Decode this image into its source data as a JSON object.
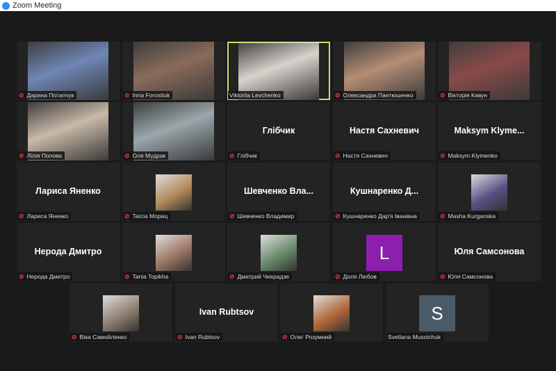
{
  "window": {
    "title": "Zoom Meeting"
  },
  "colors": {
    "active_speaker_border": "#c9e265",
    "muted_icon": "#e0393e"
  },
  "participants": [
    {
      "name": "Дарина Потапчук",
      "type": "video",
      "muted": true,
      "color": "#6f86b6"
    },
    {
      "name": "Inna Forostiuk",
      "type": "video",
      "muted": true,
      "color": "#8a6b5a"
    },
    {
      "name": "Viktoriia Levchenko",
      "type": "video",
      "muted": false,
      "active": true,
      "color": "#d9d2cc"
    },
    {
      "name": "Олександра Пантюшенко",
      "type": "video",
      "muted": true,
      "color": "#b58d75"
    },
    {
      "name": "Вікторія Кавун",
      "type": "video",
      "muted": true,
      "color": "#8a4a48"
    },
    {
      "name": "Лілія Попова",
      "type": "video",
      "muted": true,
      "color": "#c9b9a8"
    },
    {
      "name": "Оля Мудрак",
      "type": "video",
      "muted": true,
      "color": "#9aa7ab"
    },
    {
      "name": "Глібчик",
      "display": "Глібчик",
      "type": "name",
      "muted": true
    },
    {
      "name": "Настя Сахневич",
      "display": "Настя Сахневич",
      "type": "name",
      "muted": true
    },
    {
      "name": "Maksym Klymenko",
      "display": "Maksym  Klyme...",
      "type": "name",
      "muted": true
    },
    {
      "name": "Лариса Яненко",
      "display": "Лариса Яненко",
      "type": "name",
      "muted": true
    },
    {
      "name": "Taïcia Мориц",
      "type": "picture",
      "muted": true,
      "color": "#b38a5a"
    },
    {
      "name": "Шевченко Владимир",
      "display": "Шевченко  Вла...",
      "type": "name",
      "muted": true
    },
    {
      "name": "Кушнаренко Дар'я Іванівна",
      "display": "Кушнаренко  Д...",
      "type": "name",
      "muted": true
    },
    {
      "name": "Masha Kurganska",
      "type": "picture",
      "muted": true,
      "color": "#5a4f86"
    },
    {
      "name": "Нерода Дмитро",
      "display": "Нерода Дмитро",
      "type": "name",
      "muted": true
    },
    {
      "name": "Tania Topikha",
      "type": "picture",
      "muted": true,
      "color": "#9b7766"
    },
    {
      "name": "Дмитрий Чихрадзе",
      "type": "picture",
      "muted": true,
      "color": "#6a8a6a"
    },
    {
      "name": "Доля Любов",
      "type": "avatar",
      "initial": "L",
      "color": "#8c1fae",
      "muted": true
    },
    {
      "name": "Юля Самсонова",
      "display": "Юля Самсонова",
      "type": "name",
      "muted": true
    },
    {
      "name": "Віка Самойленко",
      "type": "picture",
      "muted": true,
      "color": "#8e8070"
    },
    {
      "name": "Ivan Rubtsov",
      "display": "Ivan Rubtsov",
      "type": "name",
      "muted": true
    },
    {
      "name": "Олег Розумний",
      "type": "picture",
      "muted": true,
      "color": "#b0683a"
    },
    {
      "name": "Svetlana Musoichuk",
      "type": "avatar",
      "initial": "S",
      "color": "#4a5a66",
      "muted": false
    }
  ]
}
